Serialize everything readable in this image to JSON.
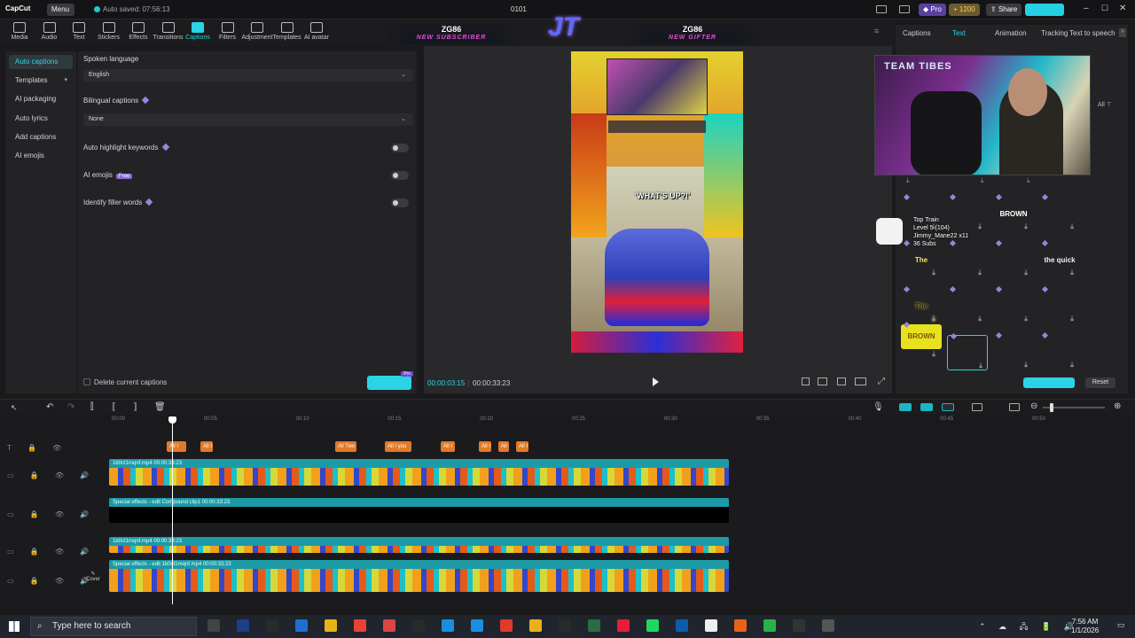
{
  "app": {
    "logo": "CapCut",
    "menu_label": "Menu",
    "autosave": "Auto saved: 07:56:13",
    "project_name": "0101",
    "pro_label": "Pro",
    "credits": "1200",
    "share_label": "Share"
  },
  "toolbar": {
    "items": [
      {
        "label": "Media",
        "icon": "media-icon"
      },
      {
        "label": "Audio",
        "icon": "audio-icon"
      },
      {
        "label": "Text",
        "icon": "text-icon"
      },
      {
        "label": "Stickers",
        "icon": "stickers-icon"
      },
      {
        "label": "Effects",
        "icon": "effects-icon"
      },
      {
        "label": "Transitions",
        "icon": "transitions-icon"
      },
      {
        "label": "Captions",
        "icon": "captions-icon",
        "active": true
      },
      {
        "label": "Filters",
        "icon": "filters-icon"
      },
      {
        "label": "Adjustment",
        "icon": "adjustment-icon"
      },
      {
        "label": "Templates",
        "icon": "templates-icon"
      },
      {
        "label": "AI avatar",
        "icon": "ai-avatar-icon"
      }
    ]
  },
  "leftnav": {
    "items": [
      "Auto captions",
      "Templates",
      "AI packaging",
      "Auto lyrics",
      "Add captions",
      "AI emojis"
    ],
    "active": "Auto captions"
  },
  "captions": {
    "spoken_language_label": "Spoken language",
    "spoken_language_value": "English",
    "bilingual_label": "Bilingual captions",
    "bilingual_value": "None",
    "auto_highlight_label": "Auto highlight keywords",
    "ai_emojis_label": "AI emojis",
    "ai_emojis_badge": "Free",
    "filler_label": "Identify filler words",
    "delete_label": "Delete current captions",
    "generate_badge": "Pro"
  },
  "preview": {
    "overlay_left_title": "ZG86",
    "overlay_left_sub": "NEW SUBSCRIBER",
    "overlay_right_title": "ZG86",
    "overlay_right_sub": "NEW GIFTER",
    "logo_text": "JT",
    "caption_text": "'WHAT'S UP?!'",
    "current_time": "00:00:03:15",
    "total_time": "00:00:33:23"
  },
  "right_panel": {
    "tabs": [
      "Captions",
      "Text",
      "Animation",
      "Tracking",
      "Text to speech"
    ],
    "active_tab": "Text",
    "all_label": "All",
    "webcam_watermark": "TEAM TIBES",
    "chat_lines": [
      "Top Train",
      "Level 5 (104)",
      "Jimmy_Mane22 x11",
      "36 Subs"
    ],
    "tiles": [
      "",
      "",
      "BROWN",
      "",
      "The",
      "",
      "",
      "the quick",
      "The",
      "",
      "",
      "",
      "BROWN",
      "",
      "",
      "",
      "",
      ""
    ],
    "reset_label": "Reset"
  },
  "timeline": {
    "ticks": [
      "00:00",
      "00:05",
      "00:10",
      "00:15",
      "00:20",
      "00:25",
      "00:30",
      "00:35",
      "00:40",
      "00:45",
      "00:50"
    ],
    "caption_clips": [
      "All I",
      "All I",
      "All Two",
      "All I you",
      "All I",
      "All I",
      "All I",
      "All I"
    ],
    "track1_label": "1b0ct1mqnf.mp4   00:00:33:23",
    "track2_label": "Special effects - edit   Compound clip1   00:00:33:23",
    "track3_label": "1b0ct1mqnf.mp4   00:00:33:23",
    "track4_label": "Special effects - edit   1b0ct1mqnf.mp4   00:00:33:23",
    "cover_label": "Cover"
  },
  "taskbar": {
    "search_placeholder": "Type here to search",
    "time": "7:56 AM",
    "date": "1/1/2026"
  },
  "colors": {
    "accent": "#2ad4e6",
    "clip_teal": "#1c9aa6",
    "caption_orange": "#e07a2a"
  }
}
